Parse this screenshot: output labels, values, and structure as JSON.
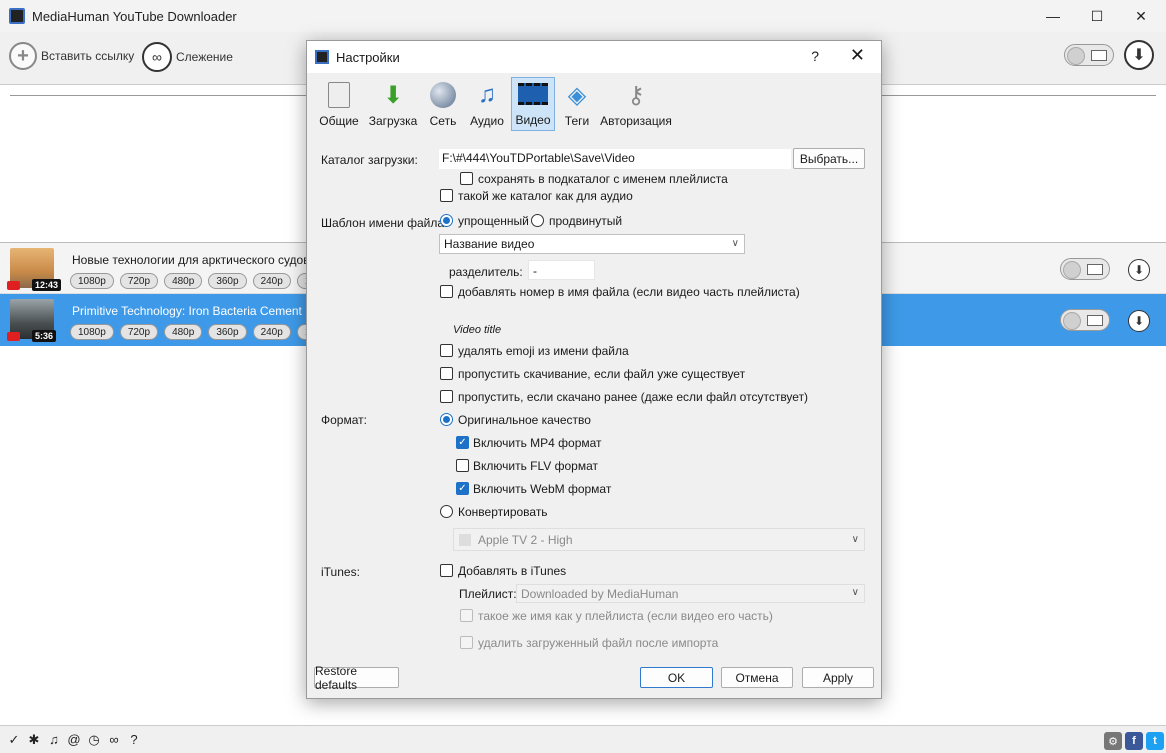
{
  "window": {
    "title": "MediaHuman YouTube Downloader",
    "minimize": "—",
    "maximize": "☐",
    "close": "✕"
  },
  "toolbar": {
    "paste_label": "Вставить ссылку",
    "tracking_label": "Слежение"
  },
  "videos": [
    {
      "title": "Новые технологии для арктического судовож",
      "duration": "12:43",
      "qualities": [
        "1080p",
        "720p",
        "480p",
        "360p",
        "240p",
        "1"
      ]
    },
    {
      "title": "Primitive Technology: Iron Bacteria Cement (no f",
      "duration": "5:36",
      "qualities": [
        "1080p",
        "720p",
        "480p",
        "360p",
        "240p",
        "1"
      ]
    }
  ],
  "dialog": {
    "title": "Настройки",
    "help": "?",
    "close": "✕",
    "tabs": [
      {
        "label": "Общие",
        "icon": "general-icon"
      },
      {
        "label": "Загрузка",
        "icon": "download-arrow-icon"
      },
      {
        "label": "Сеть",
        "icon": "globe-icon"
      },
      {
        "label": "Аудио",
        "icon": "music-note-icon"
      },
      {
        "label": "Видео",
        "icon": "film-icon"
      },
      {
        "label": "Теги",
        "icon": "tag-icon"
      },
      {
        "label": "Авторизация",
        "icon": "keys-icon"
      }
    ],
    "download_dir_label": "Каталог загрузки:",
    "download_dir_value": "F:\\#\\444\\YouTDPortable\\Save\\Video",
    "browse_button": "Выбрать...",
    "save_subfolder": "сохранять в подкаталог с именем плейлиста",
    "same_as_audio": "такой же каталог как для аудио",
    "template_label": "Шаблон имени файла:",
    "simple": "упрощенный",
    "advanced": "продвинутый",
    "template_select": "Название видео",
    "separator_label": "разделитель:",
    "separator_value": "-",
    "add_number": "добавлять номер в имя файла (если видео часть плейлиста)",
    "preview": "Video title",
    "remove_emoji": "удалять emoji из имени файла",
    "skip_existing": "пропустить скачивание, если файл уже существует",
    "skip_downloaded": "пропустить, если скачано ранее (даже если файл отсутствует)",
    "format_label": "Формат:",
    "original_quality": "Оригинальное качество",
    "mp4": "Включить MP4 формат",
    "flv": "Включить FLV формат",
    "webm": "Включить WebM формат",
    "convert": "Конвертировать",
    "convert_select": "Apple TV 2 - High",
    "itunes_label": "iTunes:",
    "add_itunes": "Добавлять в iTunes",
    "playlist_label": "Плейлист:",
    "playlist_value": "Downloaded by MediaHuman",
    "same_name": "такое же имя как у плейлиста (если видео его часть)",
    "delete_after": "удалить загруженный файл после импорта",
    "restore_defaults": "Restore defaults",
    "ok": "OK",
    "cancel": "Отмена",
    "apply": "Apply"
  },
  "statusbar": {
    "facebook": "f",
    "twitter": "t"
  }
}
